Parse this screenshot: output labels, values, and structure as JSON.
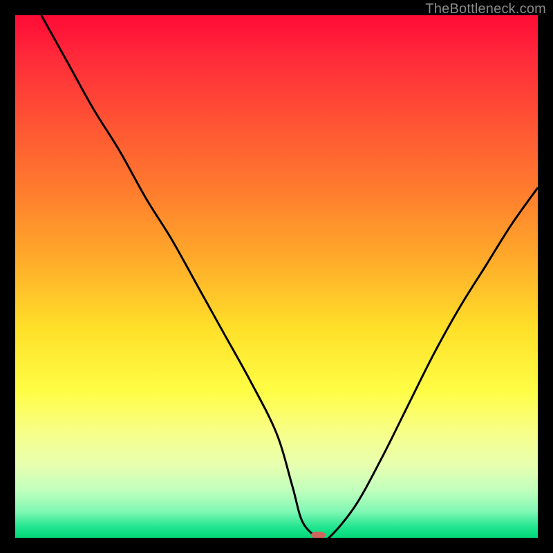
{
  "watermark": "TheBottleneck.com",
  "chart_data": {
    "type": "line",
    "title": "",
    "xlabel": "",
    "ylabel": "",
    "xlim": [
      0,
      100
    ],
    "ylim": [
      0,
      100
    ],
    "grid": false,
    "legend": false,
    "series": [
      {
        "name": "bottleneck-curve",
        "x": [
          5,
          10,
          15,
          20,
          25,
          30,
          35,
          40,
          45,
          50,
          53,
          55,
          58,
          60,
          65,
          70,
          75,
          80,
          85,
          90,
          95,
          100
        ],
        "y": [
          100,
          91,
          82,
          74,
          65,
          57,
          48,
          39,
          30,
          20,
          10,
          3,
          0,
          0,
          6,
          15,
          25,
          35,
          44,
          52,
          60,
          67
        ]
      }
    ],
    "marker": {
      "x": 58,
      "y": 0,
      "color": "#d1655d",
      "rx": 11,
      "ry": 5
    },
    "background_gradient": {
      "stops": [
        {
          "pos": 0.0,
          "color": "#ff0b35"
        },
        {
          "pos": 0.6,
          "color": "#ffe029"
        },
        {
          "pos": 0.82,
          "color": "#f7ff8a"
        },
        {
          "pos": 1.0,
          "color": "#00d879"
        }
      ]
    }
  }
}
